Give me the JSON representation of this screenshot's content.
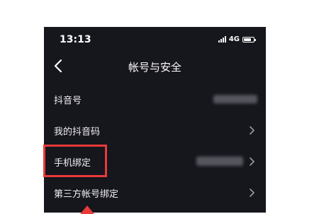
{
  "status_bar": {
    "time": "13:13",
    "network": "4G",
    "battery_level": 0.8
  },
  "nav": {
    "title": "帐号与安全",
    "back_icon": "chevron-left-icon"
  },
  "menu_items": [
    {
      "label": "抖音号",
      "has_chevron": false
    },
    {
      "label": "我的抖音码",
      "has_chevron": true
    },
    {
      "label": "手机绑定",
      "has_chevron": true
    },
    {
      "label": "第三方帐号绑定",
      "has_chevron": true
    }
  ],
  "annotation": {
    "highlight_color": "#e83a3a"
  },
  "colors": {
    "background": "#16161d",
    "text": "#ffffff",
    "chevron": "#9a9aa3"
  }
}
